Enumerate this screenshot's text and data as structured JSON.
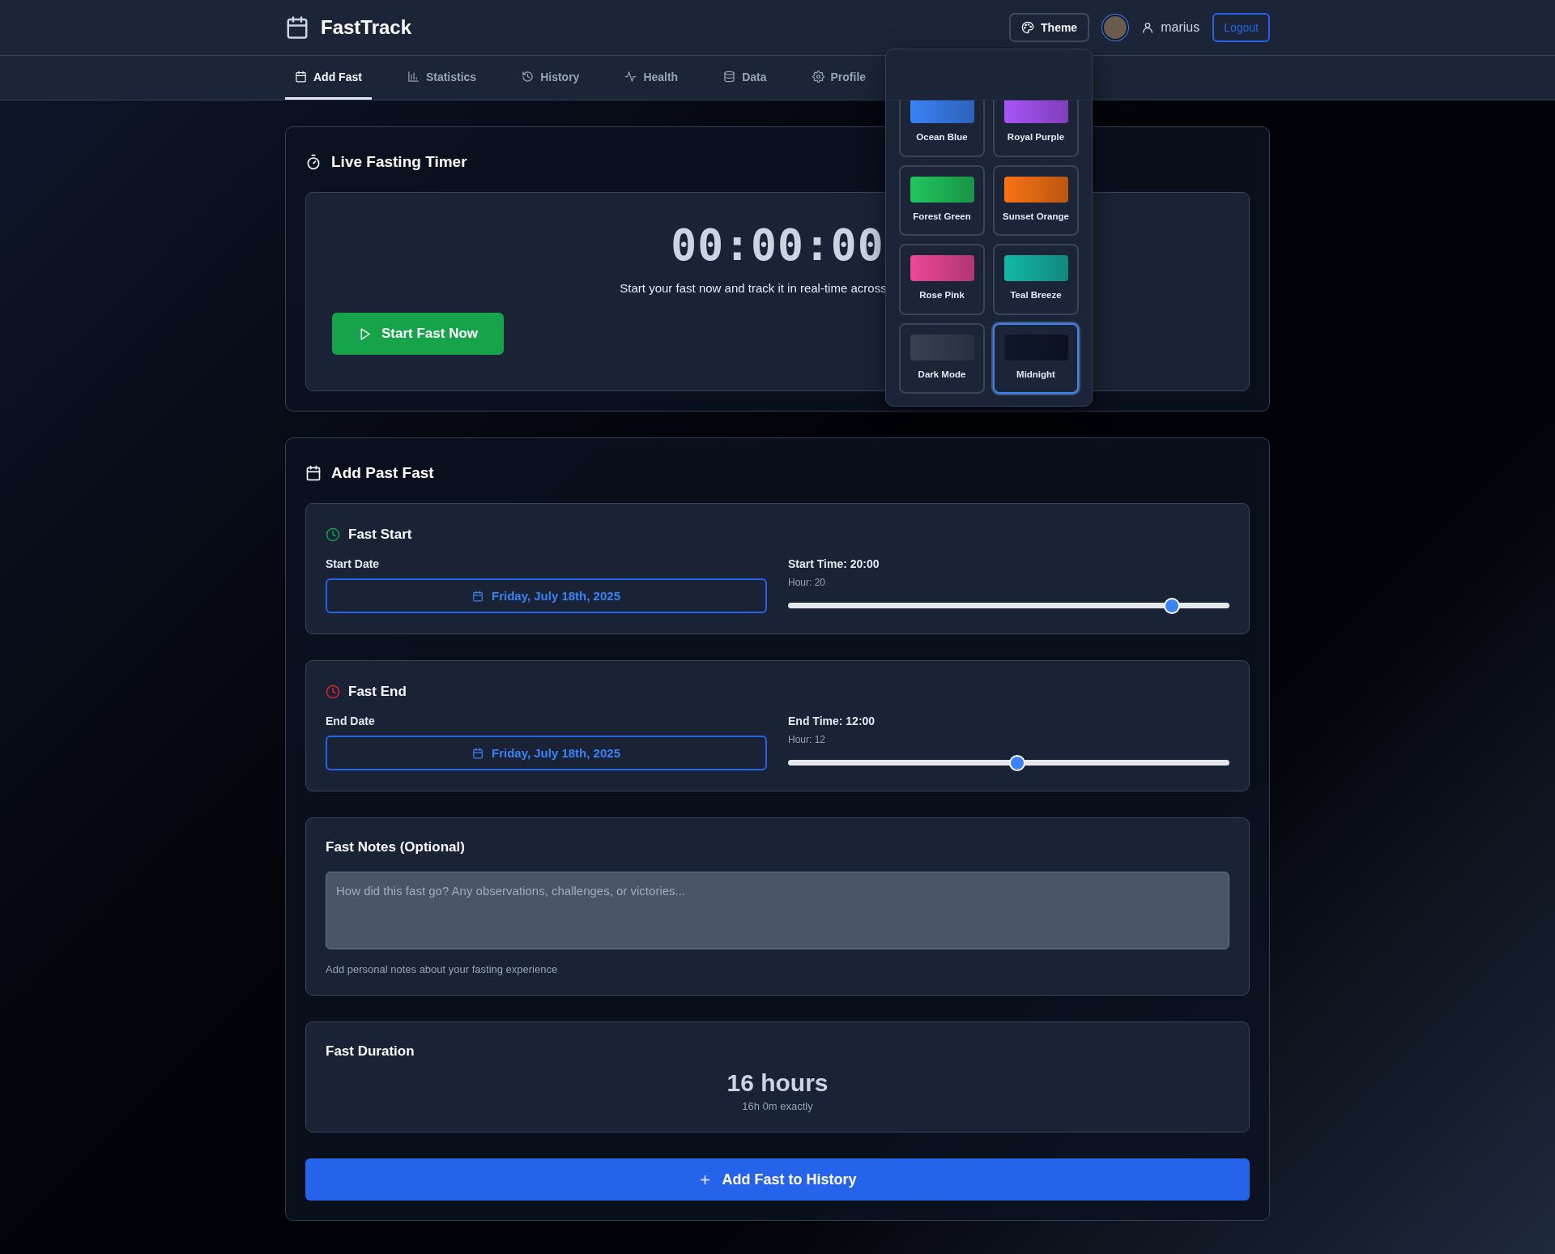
{
  "app": {
    "name": "FastTrack"
  },
  "header": {
    "theme_button": "Theme",
    "username": "marius",
    "logout": "Logout"
  },
  "nav": [
    {
      "label": "Add Fast",
      "selected": true
    },
    {
      "label": "Statistics",
      "selected": false
    },
    {
      "label": "History",
      "selected": false
    },
    {
      "label": "Health",
      "selected": false
    },
    {
      "label": "Data",
      "selected": false
    },
    {
      "label": "Profile",
      "selected": false
    }
  ],
  "theme_menu": {
    "themes": [
      {
        "name": "Ocean Blue",
        "color": "#3b82f6",
        "selected": false
      },
      {
        "name": "Royal Purple",
        "color": "#a855f7",
        "selected": false
      },
      {
        "name": "Forest Green",
        "color": "#22c55e",
        "selected": false
      },
      {
        "name": "Sunset Orange",
        "color": "#f97316",
        "selected": false
      },
      {
        "name": "Rose Pink",
        "color": "#ec4899",
        "selected": false
      },
      {
        "name": "Teal Breeze",
        "color": "#14b8a6",
        "selected": false
      },
      {
        "name": "Dark Mode",
        "color": "#374151",
        "selected": false
      },
      {
        "name": "Midnight",
        "color": "#0f172a",
        "selected": true
      }
    ]
  },
  "live_timer": {
    "title": "Live Fasting Timer",
    "time": "00:00:00",
    "caption": "Start your fast now and track it in real-time across",
    "button": "Start Fast Now"
  },
  "past_fast": {
    "title": "Add Past Fast",
    "sections": [
      {
        "kind": "start",
        "title": "Fast Start",
        "date_label": "Start Date",
        "date": "Friday, July 18th, 2025",
        "time_label": "Start Time: 20:00",
        "hour_label": "Hour: 20",
        "level": 0.87
      },
      {
        "kind": "end",
        "title": "Fast End",
        "date_label": "End Date",
        "date": "Friday, July 18th, 2025",
        "time_label": "End Time: 12:00",
        "hour_label": "Hour: 12",
        "level": 0.52
      }
    ],
    "notes": {
      "title": "Fast Notes (Optional)",
      "placeholder": "How did this fast go? Any observations, challenges, or victories...",
      "help": "Add personal notes about your fasting experience"
    },
    "duration": {
      "title": "Fast Duration",
      "value": "16 hours",
      "detail": "16h 0m exactly"
    },
    "submit": "Add Fast to History"
  }
}
